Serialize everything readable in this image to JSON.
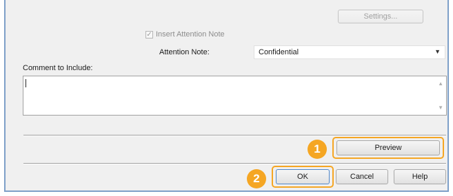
{
  "settings_button": {
    "label": "Settings..."
  },
  "insert_attention": {
    "label": "Insert Attention Note",
    "checked": true
  },
  "attention_note": {
    "label": "Attention Note:",
    "value": "Confidential"
  },
  "comment": {
    "label": "Comment to Include:",
    "value": ""
  },
  "buttons": {
    "preview": "Preview",
    "ok": "OK",
    "cancel": "Cancel",
    "help": "Help"
  },
  "callouts": {
    "one": "1",
    "two": "2"
  },
  "colors": {
    "highlight": "#f5a623",
    "frame": "#7d9fc8"
  },
  "icons": {
    "dropdown": "chevron-down-icon",
    "check": "checkmark-icon",
    "scroll_up": "scroll-up-icon",
    "scroll_down": "scroll-down-icon"
  }
}
